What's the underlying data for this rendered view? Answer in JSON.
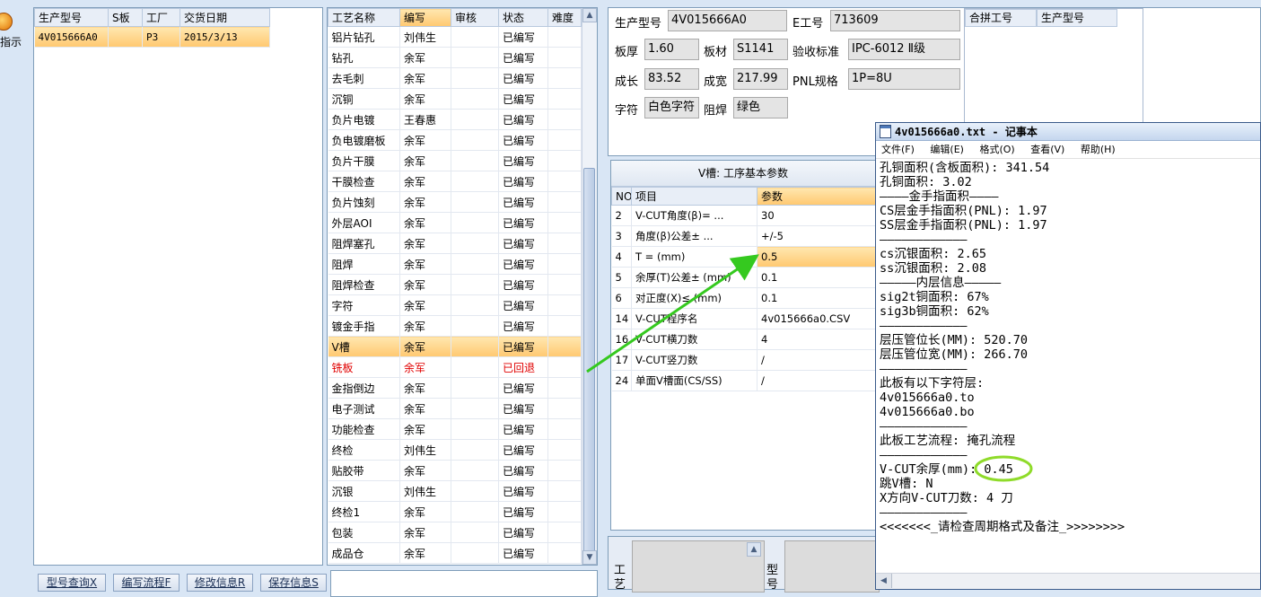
{
  "app": {
    "left_button_label": "指示",
    "bottom_buttons": [
      "型号查询X",
      "编写流程F",
      "修改信息R",
      "保存信息S"
    ]
  },
  "model_list": {
    "columns": [
      "生产型号",
      "S板",
      "工厂",
      "交货日期"
    ],
    "rows": [
      [
        "4V015666A0",
        "",
        "P3",
        "2015/3/13"
      ]
    ]
  },
  "process_list": {
    "columns": [
      "工艺名称",
      "编写",
      "审核",
      "状态",
      "难度"
    ],
    "rows": [
      [
        "铝片钻孔",
        "刘伟生",
        "",
        "已编写",
        ""
      ],
      [
        "钻孔",
        "余军",
        "",
        "已编写",
        ""
      ],
      [
        "去毛刺",
        "余军",
        "",
        "已编写",
        ""
      ],
      [
        "沉铜",
        "余军",
        "",
        "已编写",
        ""
      ],
      [
        "负片电镀",
        "王春惠",
        "",
        "已编写",
        ""
      ],
      [
        "负电镀磨板",
        "余军",
        "",
        "已编写",
        ""
      ],
      [
        "负片干膜",
        "余军",
        "",
        "已编写",
        ""
      ],
      [
        "干膜检查",
        "余军",
        "",
        "已编写",
        ""
      ],
      [
        "负片蚀刻",
        "余军",
        "",
        "已编写",
        ""
      ],
      [
        "外层AOI",
        "余军",
        "",
        "已编写",
        ""
      ],
      [
        "阻焊塞孔",
        "余军",
        "",
        "已编写",
        ""
      ],
      [
        "阻焊",
        "余军",
        "",
        "已编写",
        ""
      ],
      [
        "阻焊检查",
        "余军",
        "",
        "已编写",
        ""
      ],
      [
        "字符",
        "余军",
        "",
        "已编写",
        ""
      ],
      [
        "镀金手指",
        "余军",
        "",
        "已编写",
        ""
      ],
      [
        "V槽",
        "余军",
        "",
        "已编写",
        ""
      ],
      [
        "铣板",
        "余军",
        "",
        "已回退",
        ""
      ],
      [
        "金指倒边",
        "余军",
        "",
        "已编写",
        ""
      ],
      [
        "电子测试",
        "余军",
        "",
        "已编写",
        ""
      ],
      [
        "功能检查",
        "余军",
        "",
        "已编写",
        ""
      ],
      [
        "终检",
        "刘伟生",
        "",
        "已编写",
        ""
      ],
      [
        "贴胶带",
        "余军",
        "",
        "已编写",
        ""
      ],
      [
        "沉银",
        "刘伟生",
        "",
        "已编写",
        ""
      ],
      [
        "终检1",
        "余军",
        "",
        "已编写",
        ""
      ],
      [
        "包装",
        "余军",
        "",
        "已编写",
        ""
      ],
      [
        "成品仓",
        "余军",
        "",
        "已编写",
        ""
      ]
    ],
    "selected_index": 15,
    "returned_index": 16
  },
  "info": {
    "model_label": "生产型号",
    "model_value": "4V015666A0",
    "e_label": "E工号",
    "e_value": "713609",
    "thickness_label": "板厚",
    "thickness_value": "1.60",
    "material_label": "板材",
    "material_value": "S1141",
    "standard_label": "验收标准",
    "standard_value": "IPC-6012 Ⅱ级",
    "length_label": "成长",
    "length_value": "83.52",
    "width_label": "成宽",
    "width_value": "217.99",
    "pnl_label": "PNL规格",
    "pnl_value": "1P=8U",
    "char_label": "字符",
    "char_value": "白色字符",
    "mask_label": "阻焊",
    "mask_value": "绿色",
    "merge_col1": "合拼工号",
    "merge_col2": "生产型号"
  },
  "params": {
    "title": "V槽: 工序基本参数",
    "columns": [
      "NO",
      "项目",
      "参数"
    ],
    "rows": [
      [
        "2",
        "V-CUT角度(β)=  ...",
        "30"
      ],
      [
        "3",
        "角度(β)公差±  ...",
        "+/-5"
      ],
      [
        "4",
        "T =  (mm)",
        "0.5"
      ],
      [
        "5",
        "余厚(T)公差±  (mm)",
        "0.1"
      ],
      [
        "6",
        "对正度(X)≤ (mm)",
        "0.1"
      ],
      [
        "14",
        "V-CUT程序名",
        "4v015666a0.CSV"
      ],
      [
        "16",
        "V-CUT横刀数",
        "4"
      ],
      [
        "17",
        "V-CUT竖刀数",
        "/"
      ],
      [
        "24",
        "单面V槽面(CS/SS)",
        "/"
      ]
    ],
    "selected_index": 2
  },
  "bottom_panel": {
    "label1": "工艺",
    "label2": "型号"
  },
  "notepad": {
    "title": "4v015666a0.txt - 记事本",
    "menu": [
      "文件(F)",
      "编辑(E)",
      "格式(O)",
      "查看(V)",
      "帮助(H)"
    ],
    "lines": [
      "孔铜面积(含板面积): 341.54",
      "孔铜面积: 3.02",
      "————金手指面积————",
      "CS层金手指面积(PNL): 1.97",
      "SS层金手指面积(PNL): 1.97",
      "————————————",
      "cs沉银面积: 2.65",
      "ss沉银面积: 2.08",
      "—————内层信息—————",
      "sig2t铜面积: 67%",
      "sig3b铜面积: 62%",
      "————————————",
      "层压管位长(MM): 520.70",
      "层压管位宽(MM): 266.70",
      "————————————",
      "此板有以下字符层:",
      "4v015666a0.to",
      "4v015666a0.bo",
      "————————————",
      "此板工艺流程: 掩孔流程",
      "————————————",
      "V-CUT余厚(mm): 0.45",
      "跳V槽: N",
      "X方向V-CUT刀数: 4 刀",
      "————————————",
      "<<<<<<<_请检查周期格式及备注_>>>>>>>>"
    ]
  }
}
